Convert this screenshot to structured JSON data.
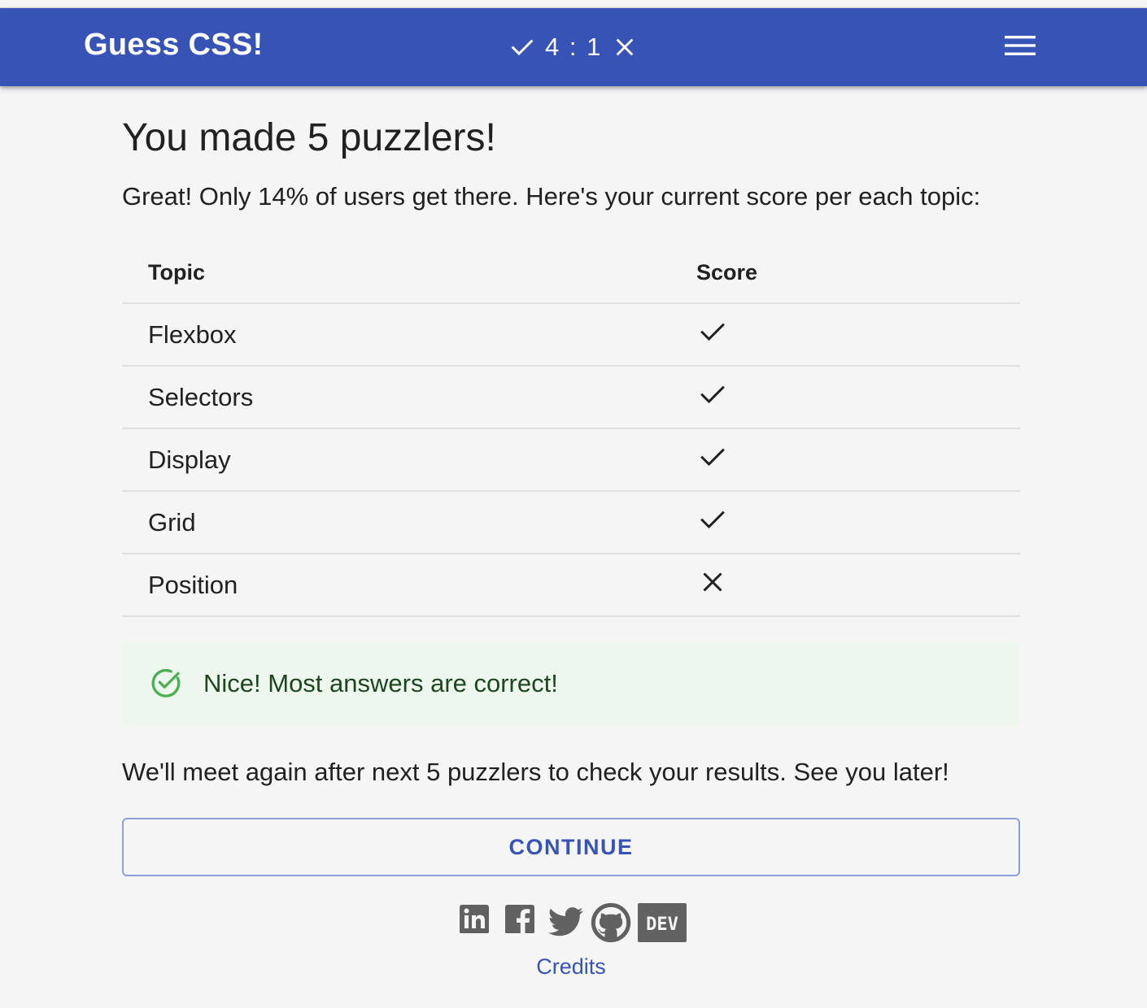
{
  "header": {
    "title": "Guess CSS!",
    "score_text": "4 : 1",
    "correct_icon": "check-icon",
    "wrong_icon": "close-icon",
    "menu_icon": "hamburger-menu-icon",
    "background_color": "#3753b5"
  },
  "main": {
    "title": "You made 5 puzzlers!",
    "intro": "Great! Only 14% of users get there. Here's your current score per each topic:",
    "table": {
      "columns": [
        "Topic",
        "Score"
      ],
      "rows": [
        {
          "topic": "Flexbox",
          "score": "correct"
        },
        {
          "topic": "Selectors",
          "score": "correct"
        },
        {
          "topic": "Display",
          "score": "correct"
        },
        {
          "topic": "Grid",
          "score": "correct"
        },
        {
          "topic": "Position",
          "score": "wrong"
        }
      ]
    },
    "alert": {
      "text": "Nice! Most answers are correct!",
      "icon": "check-circle-icon",
      "background_color": "#edf7ed",
      "icon_color": "#4caf50"
    },
    "footer_text": "We'll meet again after next 5 puzzlers to check your results. See you later!",
    "continue_label": "CONTINUE",
    "socials": [
      "linkedin-icon",
      "facebook-icon",
      "twitter-icon",
      "github-icon",
      "dev-icon"
    ],
    "dev_label": "DEV",
    "credits_label": "Credits"
  }
}
